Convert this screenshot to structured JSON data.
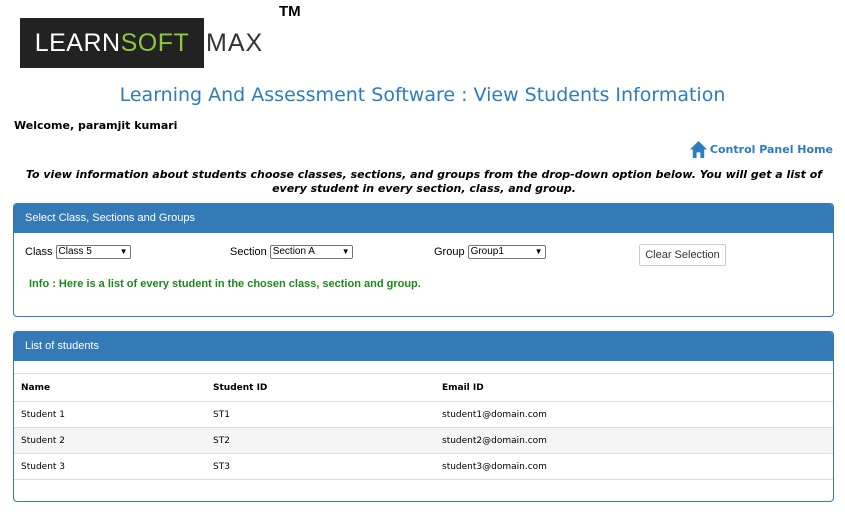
{
  "logo": {
    "learn": "LEARN",
    "soft": "SOFT",
    "max": "MAX",
    "tm": "TM"
  },
  "page_title": "Learning And Assessment Software : View Students Information",
  "welcome": "Welcome, paramjit kumari",
  "control_panel_home": "Control Panel Home",
  "instructions": "To view information about students choose classes, sections, and groups from the drop-down option below. You will get a list of every student in every section, class, and group.",
  "select_panel": {
    "heading": "Select Class, Sections and Groups",
    "class_label": "Class",
    "class_value": "Class 5",
    "section_label": "Section",
    "section_value": "Section A",
    "group_label": "Group",
    "group_value": "Group1",
    "clear_button": "Clear Selection",
    "info": "Info : Here is a list of every student in the chosen class, section and group."
  },
  "list_panel": {
    "heading": "List of students",
    "columns": [
      "Name",
      "Student ID",
      "Email ID"
    ],
    "rows": [
      [
        "Student 1",
        "ST1",
        "student1@domain.com"
      ],
      [
        "Student 2",
        "ST2",
        "student2@domain.com"
      ],
      [
        "Student 3",
        "ST3",
        "student3@domain.com"
      ]
    ]
  },
  "colors": {
    "accent": "#337ab7",
    "title": "#2e7bbf",
    "info": "#1a8a1a",
    "logo_green": "#8dc63f"
  },
  "icons": {
    "home": "home-icon",
    "dropdown": "chevron-down-icon"
  }
}
